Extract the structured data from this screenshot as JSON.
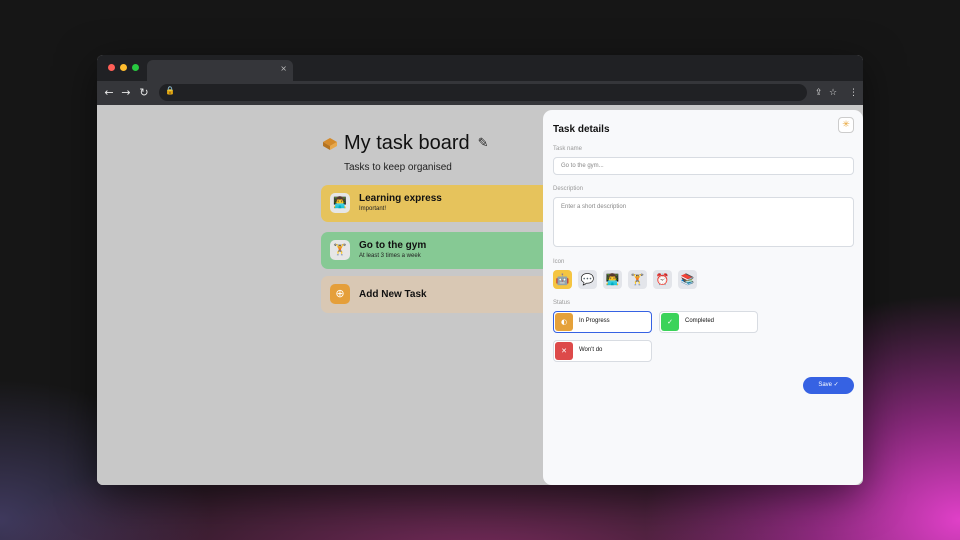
{
  "browser": {
    "tab_close": "×",
    "nav": {
      "back": "←",
      "forward": "→",
      "reload": "↻"
    },
    "toolbar_icons": {
      "share": "⇪",
      "bookmark": "☆",
      "menu": "⋮"
    },
    "colors": {
      "red": "#ff5f57",
      "yellow": "#febc2e",
      "green": "#28c840"
    }
  },
  "board": {
    "title": "My task board",
    "subtitle": "Tasks to keep organised",
    "tasks": [
      {
        "title": "Learning express",
        "description": "Important!",
        "icon": "👨‍💻",
        "color": "#e6c35c"
      },
      {
        "title": "Go to the gym",
        "description": "At least 3 times a week",
        "icon": "🏋",
        "color": "#86c994"
      },
      {
        "title": "Add New Task",
        "description": "",
        "icon": "⊕",
        "color": "#d9c8b4"
      }
    ]
  },
  "panel": {
    "title": "Task details",
    "close_icon": "✳",
    "task_name_label": "Task name",
    "task_name_placeholder": "Go to the gym...",
    "description_label": "Description",
    "description_placeholder": "Enter a short description",
    "icon_label": "Icon",
    "icons": [
      "🤖",
      "💬",
      "👨‍💻",
      "🏋",
      "⏰",
      "📚"
    ],
    "status_label": "Status",
    "statuses": [
      {
        "label": "In Progress",
        "icon": "◐",
        "color": "#e5a13a"
      },
      {
        "label": "Completed",
        "icon": "✓",
        "color": "#3bd35a"
      },
      {
        "label": "Won't do",
        "icon": "✕",
        "color": "#dd4a4a"
      }
    ],
    "save_label": "Save ✓"
  }
}
